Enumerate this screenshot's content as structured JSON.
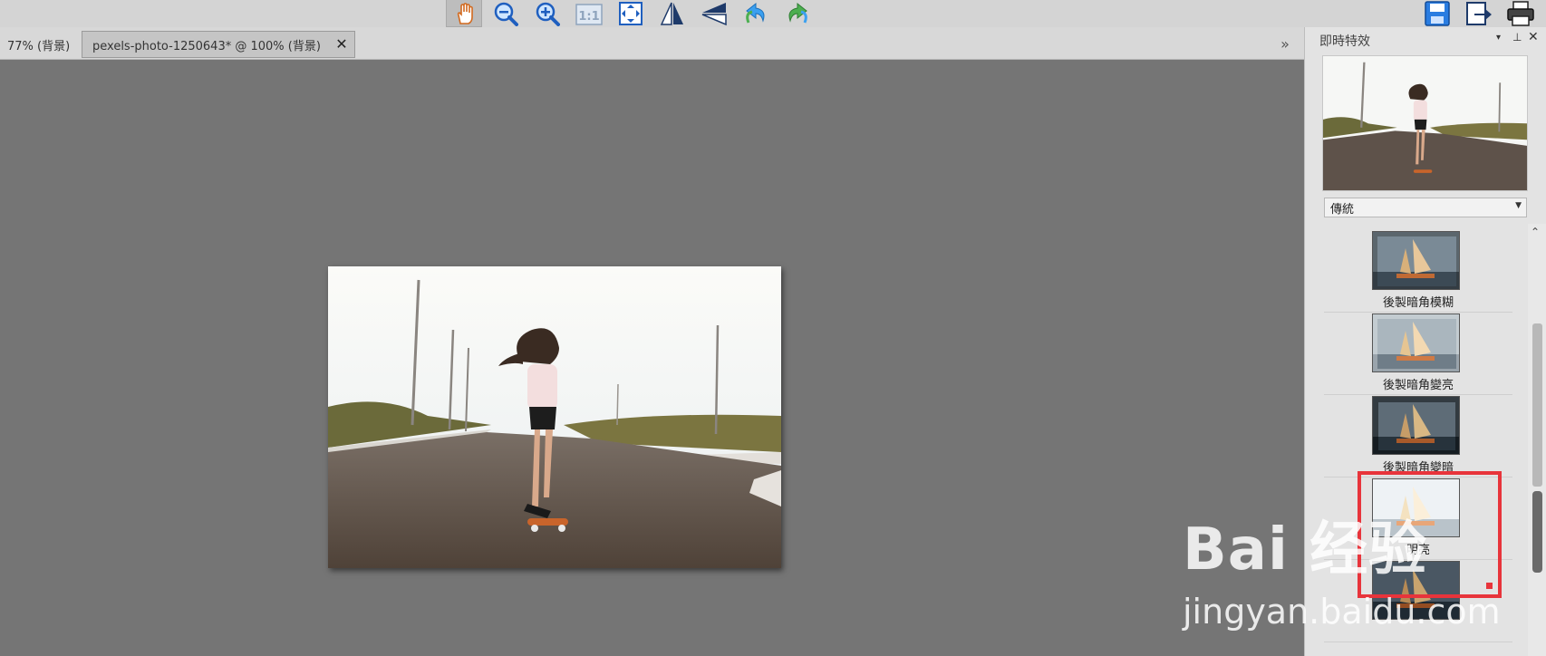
{
  "toolbar": {
    "buttons": [
      {
        "icon": "hand-icon"
      },
      {
        "icon": "zoom-out-icon"
      },
      {
        "icon": "zoom-in-icon"
      },
      {
        "icon": "actual-size-icon",
        "label": "1:1"
      },
      {
        "icon": "fit-window-icon"
      },
      {
        "icon": "flip-horizontal-icon"
      },
      {
        "icon": "flip-vertical-icon"
      },
      {
        "icon": "undo-icon"
      },
      {
        "icon": "redo-icon"
      }
    ],
    "right_buttons": [
      {
        "icon": "save-icon"
      },
      {
        "icon": "export-icon"
      },
      {
        "icon": "print-icon"
      }
    ]
  },
  "tabs": [
    {
      "label": "77% (背景)"
    },
    {
      "label": "pexels-photo-1250643* @ 100% (背景)",
      "active": true
    }
  ],
  "tab_close_glyph": "✕",
  "tab_scroll_glyph": "»",
  "panel": {
    "title": "即時特效",
    "menu_glyph": "▾",
    "pin_glyph": "⊥",
    "close_glyph": "✕",
    "preset": "傳統",
    "effects": [
      {
        "label": "後製暗角模糊"
      },
      {
        "label": "後製暗角變亮"
      },
      {
        "label": "後製暗角變暗"
      },
      {
        "label": "明亮"
      },
      {
        "label": ""
      }
    ]
  },
  "watermark": {
    "text": "Bai 经验",
    "url": "jingyan.baidu.com"
  },
  "colors": {
    "toolbar_bg": "#d4d4d4",
    "canvas_bg": "#757575",
    "panel_bg": "#e3e3e3",
    "highlight": "#e8343b"
  }
}
